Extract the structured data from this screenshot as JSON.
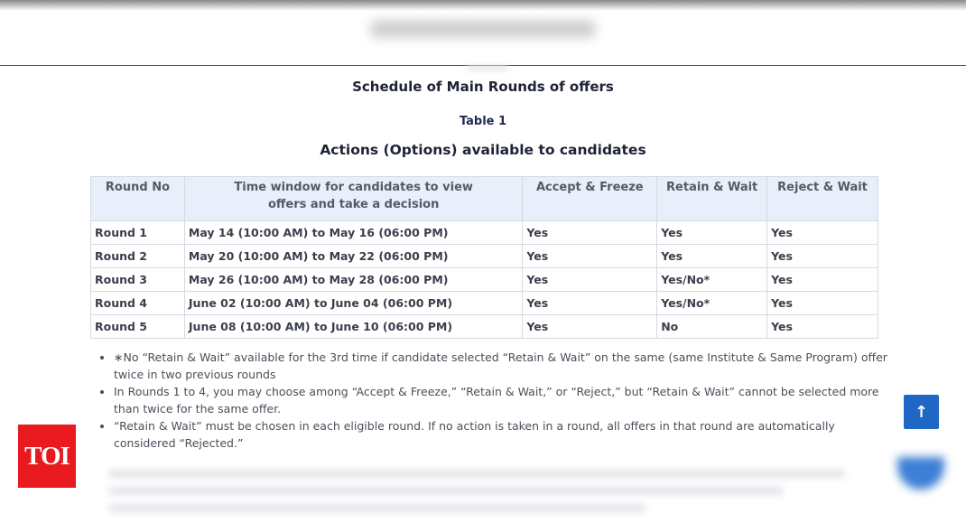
{
  "headings": {
    "main": "Schedule of Main Rounds of offers",
    "table_label": "Table 1",
    "actions": "Actions (Options) available to candidates"
  },
  "table": {
    "headers": [
      "Round No",
      "Time window for candidates to view\noffers and take a decision",
      "Accept & Freeze",
      "Retain & Wait",
      "Reject & Wait"
    ],
    "rows": [
      [
        "Round 1",
        "May 14 (10:00 AM) to May 16 (06:00 PM)",
        "Yes",
        "Yes",
        "Yes"
      ],
      [
        "Round 2",
        "May 20 (10:00 AM) to May 22 (06:00 PM)",
        "Yes",
        "Yes",
        "Yes"
      ],
      [
        "Round 3",
        "May 26 (10:00 AM) to May 28 (06:00 PM)",
        "Yes",
        "Yes/No*",
        "Yes"
      ],
      [
        "Round 4",
        "June 02 (10:00 AM) to June 04 (06:00 PM)",
        "Yes",
        "Yes/No*",
        "Yes"
      ],
      [
        "Round 5",
        "June 08 (10:00 AM) to June 10 (06:00 PM)",
        "Yes",
        "No",
        "Yes"
      ]
    ]
  },
  "notes": [
    "∗No “Retain & Wait” available for the 3rd time if candidate selected “Retain & Wait” on the same (same Institute & Same Program) offer twice in two previous rounds",
    "In Rounds 1 to 4, you may choose among “Accept & Freeze,” “Retain & Wait,” or “Reject,” but “Retain & Wait” cannot be selected more than twice for the same offer.",
    "“Retain & Wait” must be chosen in each eligible round. If no action is taken in a round, all offers in that round are automatically considered “Rejected.”"
  ],
  "scroll_top": {
    "icon": "arrow-up-icon",
    "glyph": "↑"
  },
  "logo": {
    "text": "TOI",
    "color": "#e8191f"
  },
  "colors": {
    "header_bg": "#e9eefb",
    "accent": "#1f67c4"
  }
}
